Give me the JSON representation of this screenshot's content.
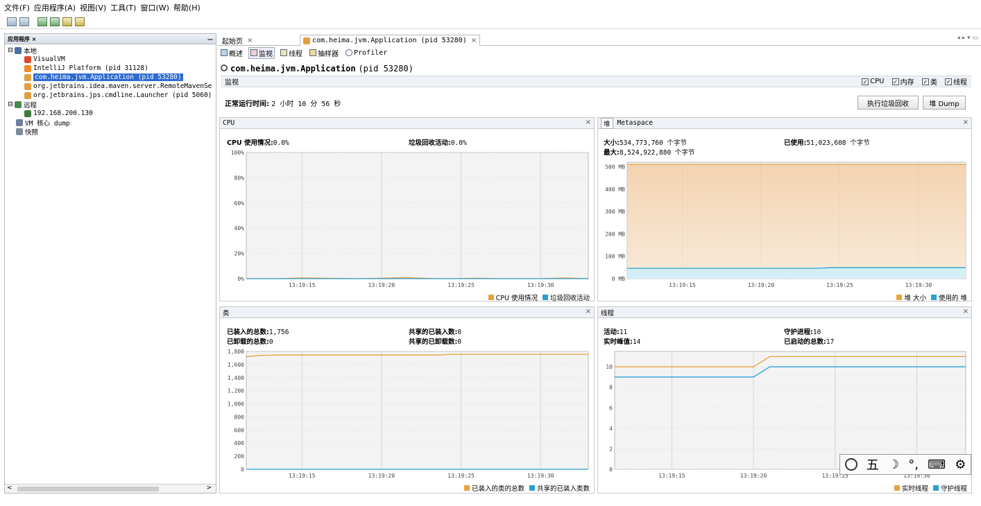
{
  "menu": [
    "文件(F)",
    "应用程序(A)",
    "视图(V)",
    "工具(T)",
    "窗口(W)",
    "帮助(H)"
  ],
  "left_panel": {
    "title": "应用程序 ×",
    "minimize": "—",
    "tree": [
      {
        "label": "本地",
        "level": 0,
        "icon": "computer-icon"
      },
      {
        "label": "VisualVM",
        "level": 2,
        "icon": "visualvm-icon"
      },
      {
        "label": "IntelliJ Platform (pid 31128)",
        "level": 2,
        "icon": "intellij-icon"
      },
      {
        "label": "com.heima.jvm.Application (pid 53280)",
        "level": 2,
        "icon": "java-icon",
        "selected": true
      },
      {
        "label": "org.jetbrains.idea.maven.server.RemoteMavenSe",
        "level": 2,
        "icon": "java-icon"
      },
      {
        "label": "org.jetbrains.jps.cmdline.Launcher (pid 5060)",
        "level": 2,
        "icon": "java-icon"
      },
      {
        "label": "远程",
        "level": 0,
        "icon": "remote-icon"
      },
      {
        "label": "192.168.200.130",
        "level": 2,
        "icon": "host-icon"
      },
      {
        "label": "VM 核心 dump",
        "level": 1,
        "icon": "coredump-icon"
      },
      {
        "label": "快照",
        "level": 1,
        "icon": "snapshot-icon"
      }
    ],
    "scroll_left": "<",
    "scroll_right": ">"
  },
  "tabs": [
    {
      "label": "起始页",
      "close": "×"
    },
    {
      "label": "com.heima.jvm.Application (pid 53280)",
      "close": "×",
      "active": true
    }
  ],
  "tab_nav": "◂ ▸ ▾ ▭",
  "subtabs": [
    {
      "label": "概述",
      "icon": "overview-icon"
    },
    {
      "label": "监视",
      "icon": "monitor-icon",
      "active": true
    },
    {
      "label": "线程",
      "icon": "threads-icon"
    },
    {
      "label": "抽样器",
      "icon": "sampler-icon"
    },
    {
      "label": "Profiler",
      "icon": "profiler-icon"
    }
  ],
  "app_title": {
    "name": "com.heima.jvm.Application",
    "pid": "(pid 53280)"
  },
  "section": {
    "title": "监视",
    "checkboxes": [
      "CPU",
      "内存",
      "类",
      "线程"
    ]
  },
  "uptime": {
    "label": "正常运行时间:",
    "value": "2 小时 10 分 56 秒"
  },
  "buttons": {
    "gc": "执行垃圾回收",
    "heap_dump": "堆 Dump"
  },
  "colors": {
    "orange": "#e8a33d",
    "blue": "#2aa0d4",
    "heap_fill": "#f3c99b",
    "heap_fill_light": "#fbe7d2",
    "used_fill": "#cfeefa"
  },
  "cpu_panel": {
    "title": "CPU",
    "close": "×",
    "stat1_label": "CPU 使用情况:",
    "stat1_value": "0.0%",
    "stat2_label": "垃圾回收活动:",
    "stat2_value": "0.0%",
    "legend": [
      "CPU 使用情况",
      "垃圾回收活动"
    ]
  },
  "heap_panel": {
    "title_tab1": "堆",
    "title_tab2": "Metaspace",
    "close": "×",
    "size_label": "大小:",
    "size_value": "534,773,760 个字节",
    "max_label": "最大:",
    "max_value": "8,524,922,880 个字节",
    "used_label": "已使用:",
    "used_value": "51,023,608 个字节",
    "legend": [
      "堆 大小",
      "使用的 堆"
    ]
  },
  "classes_panel": {
    "title": "类",
    "close": "×",
    "loaded_label": "已装入的总数:",
    "loaded_value": "1,756",
    "unloaded_label": "已卸载的总数:",
    "unloaded_value": "0",
    "shared_loaded_label": "共享的已装入数:",
    "shared_loaded_value": "0",
    "shared_unloaded_label": "共享的已卸载数:",
    "shared_unloaded_value": "0",
    "legend": [
      "已装入的类的总数",
      "共享的已装入类数"
    ]
  },
  "threads_panel": {
    "title": "线程",
    "close": "×",
    "live_label": "活动:",
    "live_value": "11",
    "peak_label": "实时峰值:",
    "peak_value": "14",
    "daemon_label": "守护进程:",
    "daemon_value": "10",
    "started_label": "已启动的总数:",
    "started_value": "17",
    "legend": [
      "实时线程",
      "守护线程"
    ]
  },
  "ime_toolbar": [
    "五",
    "☽",
    "°,",
    "⌨",
    "⚙"
  ],
  "chart_data": [
    {
      "type": "area",
      "name": "cpu",
      "x_ticks": [
        "13:19:15",
        "13:19:20",
        "13:19:25",
        "13:19:30"
      ],
      "y_ticks": [
        "0%",
        "20%",
        "40%",
        "60%",
        "80%",
        "100%"
      ],
      "ylim": [
        0,
        100
      ],
      "x": [
        0,
        2,
        3.5,
        5,
        7,
        8,
        10,
        12,
        13,
        14.5,
        16,
        18.5,
        20,
        21.5
      ],
      "series": [
        {
          "name": "CPU 使用情况",
          "values": [
            0,
            0,
            0.6,
            0.3,
            0,
            0.2,
            0.9,
            0,
            0,
            0.4,
            0,
            0,
            0.6,
            0
          ]
        },
        {
          "name": "垃圾回收活动",
          "values": [
            0,
            0,
            0,
            0,
            0,
            0,
            0,
            0,
            0,
            0,
            0,
            0,
            0,
            0
          ]
        }
      ]
    },
    {
      "type": "area",
      "name": "heap",
      "x_ticks": [
        "13:19:15",
        "13:19:20",
        "13:19:25",
        "13:19:30"
      ],
      "y_ticks": [
        "0 MB",
        "100 MB",
        "200 MB",
        "300 MB",
        "400 MB",
        "500 MB"
      ],
      "ylim": [
        0,
        520
      ],
      "x": [
        0,
        12,
        13,
        21.5
      ],
      "series": [
        {
          "name": "堆 大小",
          "values": [
            510,
            510,
            510,
            510
          ]
        },
        {
          "name": "使用的 堆",
          "values": [
            46,
            46,
            49,
            49
          ]
        }
      ]
    },
    {
      "type": "line",
      "name": "classes",
      "x_ticks": [
        "13:19:15",
        "13:19:20",
        "13:19:25",
        "13:19:30"
      ],
      "y_ticks": [
        "0",
        "200",
        "400",
        "600",
        "800",
        "1,000",
        "1,200",
        "1,400",
        "1,600",
        "1,800"
      ],
      "ylim": [
        0,
        1800
      ],
      "x": [
        0,
        1,
        2,
        12,
        13,
        21.5
      ],
      "series": [
        {
          "name": "已装入的类的总数",
          "values": [
            1720,
            1740,
            1745,
            1745,
            1756,
            1756
          ]
        },
        {
          "name": "共享的已装入类数",
          "values": [
            0,
            0,
            0,
            0,
            0,
            0
          ]
        }
      ]
    },
    {
      "type": "line",
      "name": "threads",
      "x_ticks": [
        "13:19:15",
        "13:19:20",
        "13:19:25",
        "13:19:30"
      ],
      "y_ticks": [
        "0",
        "2",
        "4",
        "6",
        "8",
        "10"
      ],
      "ylim": [
        0,
        11.5
      ],
      "x": [
        0,
        8.5,
        9.5,
        21.5
      ],
      "series": [
        {
          "name": "实时线程",
          "values": [
            10,
            10,
            11,
            11
          ]
        },
        {
          "name": "守护线程",
          "values": [
            9,
            9,
            10,
            10
          ]
        }
      ]
    }
  ]
}
